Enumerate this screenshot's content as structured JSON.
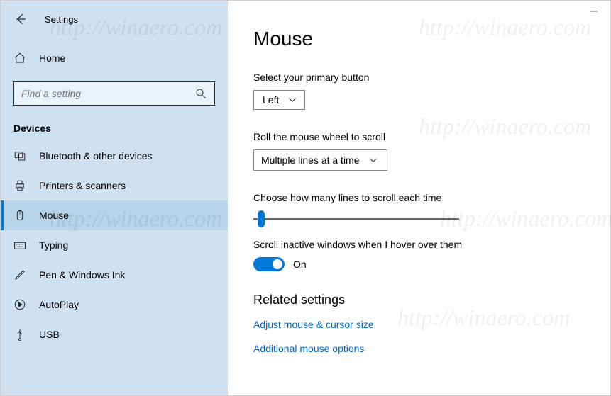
{
  "window": {
    "title": "Settings"
  },
  "sidebar": {
    "home": "Home",
    "search_placeholder": "Find a setting",
    "category": "Devices",
    "items": [
      {
        "label": "Bluetooth & other devices"
      },
      {
        "label": "Printers & scanners"
      },
      {
        "label": "Mouse"
      },
      {
        "label": "Typing"
      },
      {
        "label": "Pen & Windows Ink"
      },
      {
        "label": "AutoPlay"
      },
      {
        "label": "USB"
      }
    ]
  },
  "page": {
    "title": "Mouse",
    "primary_button_label": "Select your primary button",
    "primary_button_value": "Left",
    "wheel_label": "Roll the mouse wheel to scroll",
    "wheel_value": "Multiple lines at a time",
    "lines_label": "Choose how many lines to scroll each time",
    "inactive_label": "Scroll inactive windows when I hover over them",
    "toggle_value": "On",
    "related_header": "Related settings",
    "link1": "Adjust mouse & cursor size",
    "link2": "Additional mouse options"
  },
  "watermark": "http://winaero.com"
}
